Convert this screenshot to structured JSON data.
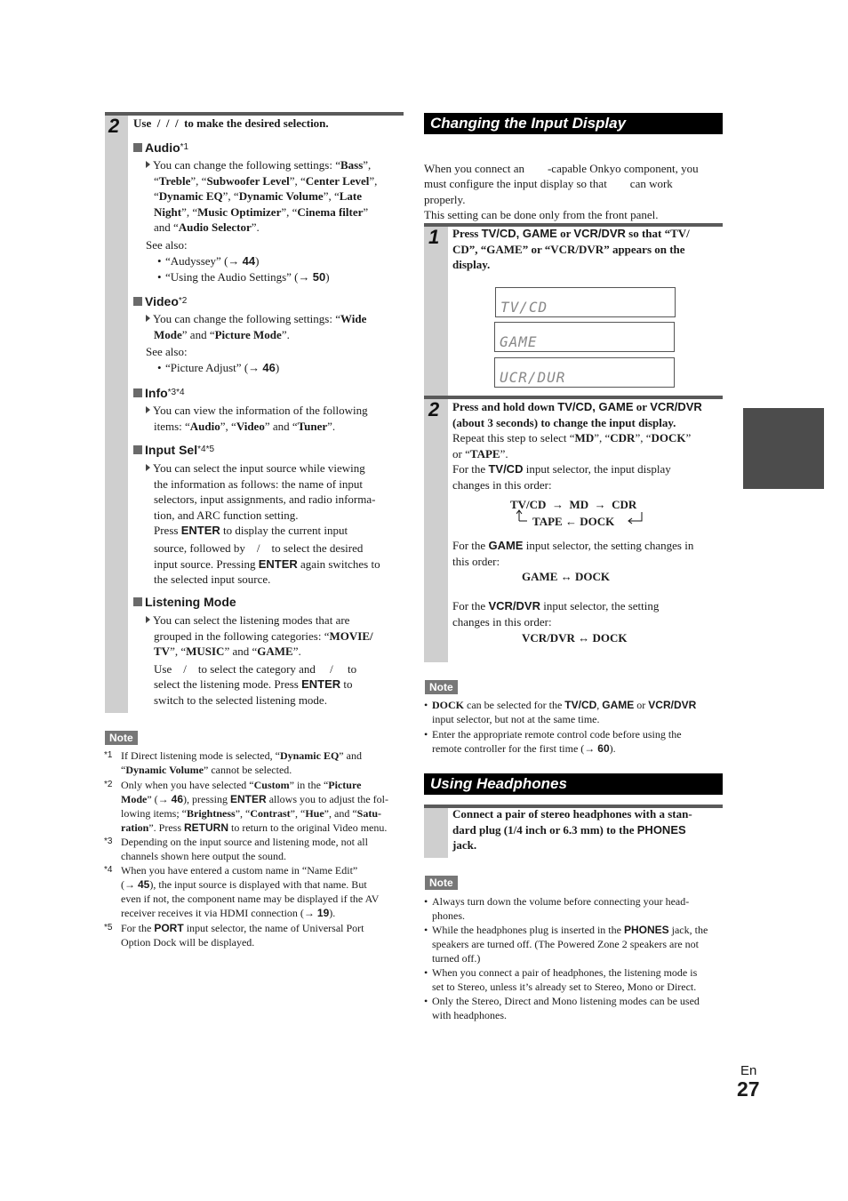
{
  "left": {
    "step_number": "2",
    "step_instruction": {
      "pre": "Use",
      "arrows": "  /  /  /  ",
      "post": "to make the desired selection."
    },
    "audio": {
      "title": "Audio",
      "sup": "*1",
      "desc_1": "You can change the following settings: “",
      "Bass": "Bass",
      "sep1": "”,",
      "Treble": "Treble",
      "Subwoofer": "Subwoofer Level",
      "Center": "Center Level",
      "DynEQ": "Dynamic EQ",
      "DynVol": "Dynamic Volume",
      "Late": "Late",
      "Night": "Night",
      "MusicOpt": "Music Optimizer",
      "Cinema": "Cinema filter",
      "AudioSel": "Audio Selector",
      "see_also": "See also:",
      "refs": [
        {
          "text": "“Audyssey” (→ ",
          "page": "44"
        },
        {
          "text": "“Using the Audio Settings” (→ ",
          "page": "50"
        }
      ]
    },
    "video": {
      "title": "Video",
      "sup": "*2",
      "desc_pre": "You can change the following settings: “",
      "Wide": "Wide",
      "Mode": "Mode",
      "and": "” and “",
      "PictureMode": "Picture Mode",
      "end": "”.",
      "see_also": "See also:",
      "refs": [
        {
          "text": "“Picture Adjust” (→ ",
          "page": "46"
        }
      ]
    },
    "info": {
      "title": "Info",
      "sup": "*3*4",
      "line1": "You can view the information of the following",
      "items_pre": "items: “",
      "Audio": "Audio",
      "Video": "Video",
      "Tuner": "Tuner"
    },
    "input_sel": {
      "title": "Input Sel",
      "sup": "*4*5",
      "lines": [
        "You can select the input source while viewing",
        "the information as follows: the name of input",
        "selectors, input assignments, and radio informa-",
        "tion, and ARC function setting."
      ],
      "press": "Press",
      "enter": "ENTER",
      "press_rest": "to display the current input",
      "line6": "source, followed by    /    to select the desired",
      "line7_pre": "input source. Pressing",
      "line7_post": "again switches to",
      "line8": "the selected input source."
    },
    "listening_mode": {
      "title": "Listening Mode",
      "line1": "You can select the listening modes that are",
      "line2_pre": "grouped in the following categories: “",
      "MOVIE": "MOVIE/",
      "TV": "TV",
      "MUSIC": "MUSIC",
      "GAME": "GAME",
      "line4": "Use    /    to select the category and     /     to",
      "line5_pre": "select the listening mode. Press",
      "enter": "ENTER",
      "line5_post": "to",
      "line6": "switch to the selected listening mode."
    },
    "note_label": "Note",
    "footnotes": [
      {
        "mark": "*1"
      },
      {
        "mark": "*2"
      },
      {
        "mark": "*3",
        "lines": [
          "Depending on the input source and listening mode, not all",
          "channels shown here output the sound."
        ]
      },
      {
        "mark": "*4"
      },
      {
        "mark": "*5"
      }
    ],
    "fn1": {
      "pre": "If Direct listening mode is selected, “",
      "DynEQ": "Dynamic EQ",
      "mid": "” and",
      "q": "“",
      "DynVol": "Dynamic Volume",
      "post": "” cannot be selected."
    },
    "fn2": {
      "pre": "Only when you have selected “",
      "Custom": "Custom",
      "mid": "” in the “",
      "Picture": "Picture",
      "Mode": "Mode",
      "ref_pre": "” (→ ",
      "page": "46",
      "ref_post": "), pressing",
      "enter": "ENTER",
      "allows": "allows you to adjust the fol-",
      "lowing": "lowing items; “",
      "Brightness": "Brightness",
      "Contrast": "Contrast",
      "Hue": "Hue",
      "Satu": "Satu-",
      "ration": "ration",
      "press": "”. Press",
      "return": "RETURN",
      "rest": "to return to the original Video menu."
    },
    "fn4": {
      "line1": "When you have entered a custom name in “Name Edit”",
      "ref_pre": "(→ ",
      "page": "45",
      "line2_post": "), the input source is displayed with that name. But",
      "line3": "even if not, the component name may be displayed if the AV",
      "line4_pre": "receiver receives it via HDMI connection (→ ",
      "page2": "19",
      "line4_post": ")."
    },
    "fn5": {
      "pre": "For the",
      "port": "PORT",
      "post": "input selector, the name of Universal Port",
      "line2": "Option Dock will be displayed."
    }
  },
  "right": {
    "section1_title": "Changing the Input Display",
    "intro": [
      "When you connect an        -capable Onkyo component, you",
      "must configure the input display so that        can work",
      "properly.",
      "This setting can be done only from the front panel."
    ],
    "step1": {
      "number": "1",
      "pre": "Press",
      "keys": "TV/CD, GAME",
      "or": "or",
      "vcr": "VCR/DVR",
      "post": "so that “TV/",
      "line2": "CD”, “GAME” or “VCR/DVR” appears on the",
      "line3": "display.",
      "displays": [
        "TV/CD",
        "GAME",
        "UCR/DUR"
      ]
    },
    "step2": {
      "number": "2",
      "l1_pre": "Press and hold down",
      "tvcd": "TV/CD",
      "game": "GAME",
      "or": "or",
      "vcr": "VCR/DVR",
      "l2": "(about 3 seconds) to change the input display.",
      "l3_pre": "Repeat this step to select “",
      "MD": "MD",
      "CDR": "CDR",
      "DOCK": "DOCK",
      "l4_pre": "or “",
      "TAPE": "TAPE",
      "l5_pre": "For the",
      "l5_key": "TV/CD",
      "l5_post": "input selector, the input display",
      "l6": "changes in this order:",
      "flow1": "TV/CD  →  MD  →  CDR",
      "flow2": "TAPE ← DOCK",
      "game_pre": "For the",
      "game_key": "GAME",
      "game_post": "input selector, the setting changes in",
      "game_l2": "this order:",
      "game_flow": "GAME ↔ DOCK",
      "vcr_pre": "For the",
      "vcr_key": "VCR/DVR",
      "vcr_post": "input selector, the setting",
      "vcr_l2": "changes in this order:",
      "vcr_flow": "VCR/DVR ↔ DOCK"
    },
    "note1_label": "Note",
    "note1": {
      "b1_dock": "DOCK",
      "b1_mid": "can be selected for the",
      "b1_tvcd": "TV/CD",
      "b1_game": "GAME",
      "b1_or": "or",
      "b1_vcr": "VCR/DVR",
      "b1_l2": "input selector, but not at the same time.",
      "b2_l1": "Enter the appropriate remote control code before using the",
      "b2_l2_pre": "remote controller for the first time (→ ",
      "b2_page": "60",
      "b2_post": ")."
    },
    "section2_title": "Using Headphones",
    "headphones_step": {
      "l1": "Connect a pair of stereo headphones with a stan-",
      "l2_pre": "dard plug (1/4 inch or 6.3 mm) to the",
      "phones": "PHONES",
      "l3": "jack."
    },
    "note2_label": "Note",
    "note2": {
      "b1": [
        "Always turn down the volume before connecting your head-",
        "phones."
      ],
      "b2_pre": "While the headphones plug is inserted in the",
      "b2_phones": "PHONES",
      "b2_post": "jack, the",
      "b2_l2": "speakers are turned off. (The Powered Zone 2 speakers are not",
      "b2_l3": "turned off.)",
      "b3": [
        "When you connect a pair of headphones, the listening mode is",
        "set to Stereo, unless it’s already set to Stereo, Mono or Direct."
      ],
      "b4": [
        "Only the Stereo, Direct and Mono listening modes can be used",
        "with headphones."
      ]
    }
  },
  "footer": {
    "lang": "En",
    "page": "27"
  },
  "colors": {
    "tab_marker": "#4c4c4c",
    "step_bar": "#cfcfcf",
    "note_badge": "#777777",
    "section_bg": "#000000"
  }
}
